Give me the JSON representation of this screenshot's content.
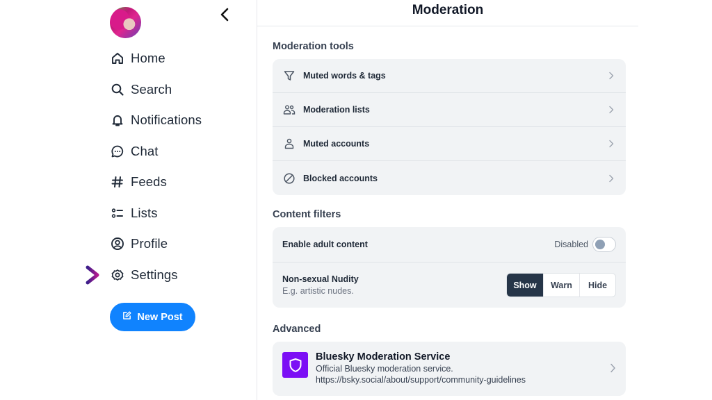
{
  "sidebar": {
    "back_icon": "chevron-left-icon",
    "nav": [
      {
        "label": "Home",
        "icon": "home-icon"
      },
      {
        "label": "Search",
        "icon": "search-icon"
      },
      {
        "label": "Notifications",
        "icon": "bell-icon"
      },
      {
        "label": "Chat",
        "icon": "chat-bubble-icon"
      },
      {
        "label": "Feeds",
        "icon": "hashtag-icon"
      },
      {
        "label": "Lists",
        "icon": "list-icon"
      },
      {
        "label": "Profile",
        "icon": "user-circle-icon"
      },
      {
        "label": "Settings",
        "icon": "gear-icon"
      }
    ],
    "new_post_label": "New Post",
    "annotation_arrow_color": "#8b1a8f"
  },
  "header": {
    "title": "Moderation"
  },
  "moderation_tools": {
    "title": "Moderation tools",
    "items": [
      {
        "label": "Muted words & tags",
        "icon": "filter-icon"
      },
      {
        "label": "Moderation lists",
        "icon": "users-icon"
      },
      {
        "label": "Muted accounts",
        "icon": "user-icon"
      },
      {
        "label": "Blocked accounts",
        "icon": "block-icon"
      }
    ]
  },
  "content_filters": {
    "title": "Content filters",
    "adult_content": {
      "label": "Enable adult content",
      "state": "Disabled",
      "enabled": false
    },
    "nudity": {
      "label": "Non-sexual Nudity",
      "description": "E.g. artistic nudes.",
      "options": [
        "Show",
        "Warn",
        "Hide"
      ],
      "selected": "Show"
    }
  },
  "advanced": {
    "title": "Advanced",
    "service": {
      "name": "Bluesky Moderation Service",
      "description": "Official Bluesky moderation service.",
      "url": "https://bsky.social/about/support/community-guidelines",
      "logo_color": "#7c0ff5"
    }
  },
  "colors": {
    "accent": "#1083fe",
    "selected_segment": "#263548",
    "card_bg": "#f1f3f5"
  }
}
